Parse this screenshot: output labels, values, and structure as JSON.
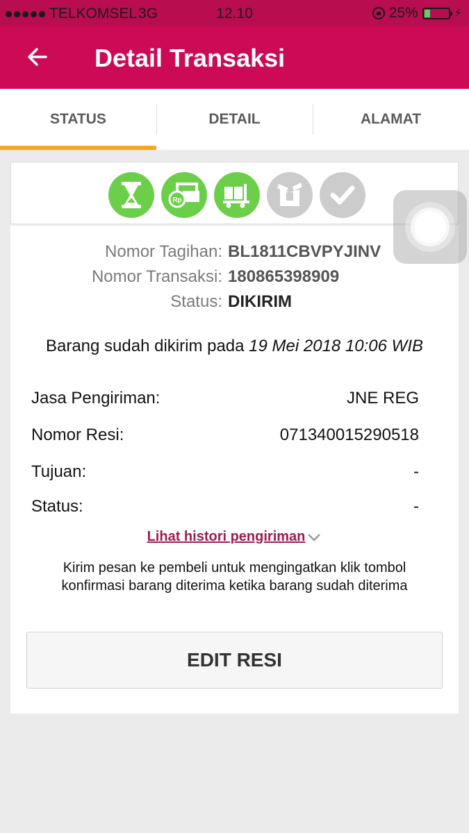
{
  "statusbar": {
    "carrier": "TELKOMSEL",
    "network": "3G",
    "time": "12.10",
    "battery": "25%",
    "battery_level": 0.25,
    "battery_color": "#4cd964"
  },
  "header": {
    "title": "Detail Transaksi",
    "back_icon": "arrow-left-icon",
    "color": "#cc0a56"
  },
  "tabs": [
    {
      "label": "STATUS",
      "active": true
    },
    {
      "label": "DETAIL",
      "active": false
    },
    {
      "label": "ALAMAT",
      "active": false
    }
  ],
  "progress_steps": [
    {
      "icon": "hourglass-icon",
      "done": true
    },
    {
      "icon": "payment-icon",
      "done": true
    },
    {
      "icon": "truck-icon",
      "done": true
    },
    {
      "icon": "package-icon",
      "done": false
    },
    {
      "icon": "check-icon",
      "done": false
    }
  ],
  "invoice": {
    "tagihan_label": "Nomor Tagihan:",
    "tagihan_value": "BL1811CBVPYJINV",
    "transaksi_label": "Nomor Transaksi:",
    "transaksi_value": "180865398909",
    "status_label": "Status:",
    "status_value": "DIKIRIM"
  },
  "sent": {
    "prefix": "Barang sudah dikirim pada",
    "date": "19 Mei 2018 10:06 WIB"
  },
  "shipping": {
    "jasa_label": "Jasa Pengiriman:",
    "jasa_value": "JNE REG",
    "resi_label": "Nomor Resi:",
    "resi_value": "071340015290518",
    "tujuan_label": "Tujuan:",
    "tujuan_value": "-",
    "status_label": "Status:",
    "status_value": "-"
  },
  "history_link": "Lihat histori pengiriman",
  "notice": "Kirim pesan ke pembeli untuk mengingatkan klik tombol konfirmasi barang diterima ketika barang sudah diterima",
  "edit_button": "EDIT RESI"
}
